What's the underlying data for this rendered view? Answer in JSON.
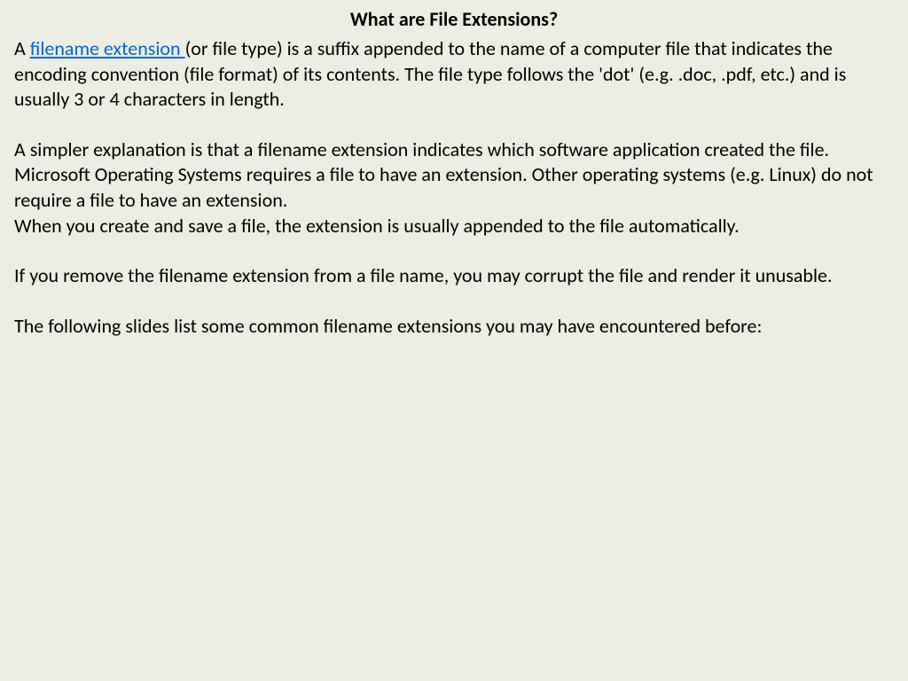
{
  "title": "What are File Extensions?",
  "para1_prefix": "A ",
  "para1_link": "filename extension ",
  "para1_suffix": " (or file type) is a suffix appended to the name of a computer file that indicates the encoding convention (file format) of its contents. The file type follows the 'dot' (e.g.   .doc, .pdf, etc.) and is usually 3 or 4 characters in length.",
  "para2": "A simpler explanation is that a filename extension indicates which software application created the file. Microsoft Operating Systems requires a file to have an extension. Other operating systems (e.g. Linux) do not require a file to have an extension.",
  "para3": "When you create and save a file, the extension is usually appended to the file automatically.",
  "para4": "If you remove the filename extension from a file name, you may corrupt the file and render it unusable.",
  "para5": "The following slides list some common filename extensions you may have encountered before:"
}
